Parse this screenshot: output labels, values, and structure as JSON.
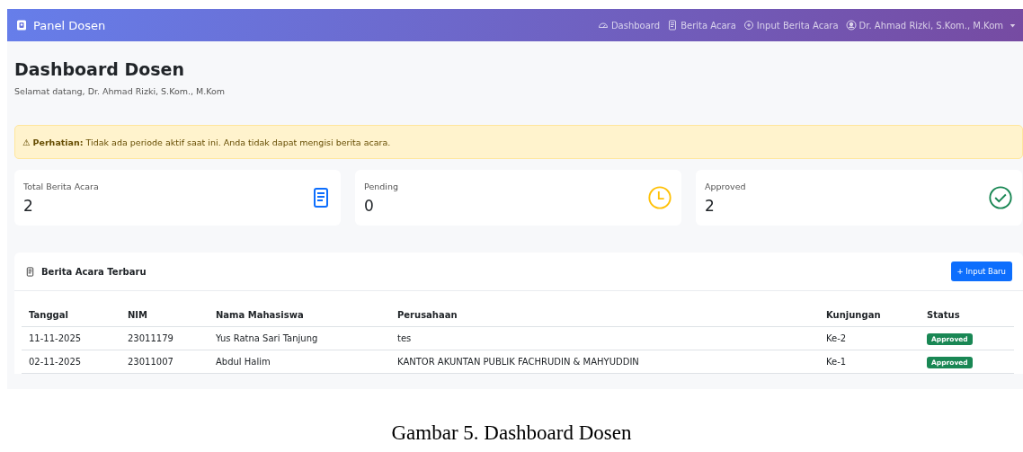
{
  "navbar": {
    "brand": "Panel Dosen",
    "items": [
      {
        "kind": "dashboard",
        "label": "Dashboard"
      },
      {
        "kind": "document",
        "label": "Berita Acara"
      },
      {
        "kind": "plus",
        "label": "Input Berita Acara"
      },
      {
        "kind": "user",
        "label": "Dr. Ahmad Rizki, S.Kom., M.Kom",
        "dropdown": true
      }
    ]
  },
  "page": {
    "title": "Dashboard Dosen",
    "subtitle": "Selamat datang, Dr. Ahmad Rizki, S.Kom., M.Kom"
  },
  "alert": {
    "icon": "⚠",
    "text": "**Perhatian:** Tidak ada periode aktif saat ini. Anda tidak dapat mengisi berita acara."
  },
  "stats": [
    {
      "kind": "document",
      "label": "Total Berita Acara",
      "value": "2",
      "color": "#0d6efd"
    },
    {
      "kind": "clock",
      "label": "Pending",
      "value": "0",
      "color": "#ffc107"
    },
    {
      "kind": "check",
      "label": "Approved",
      "value": "2",
      "color": "#198754"
    }
  ],
  "table": {
    "title": "Berita Acara Terbaru",
    "button": "+ Input Baru",
    "columns": [
      "Tanggal",
      "NIM",
      "Nama Mahasiswa",
      "Perusahaan",
      "Kunjungan",
      "Status"
    ],
    "rows": [
      [
        "11-11-2025",
        "23011179",
        "Yus Ratna Sari Tanjung",
        "tes",
        "Ke-2",
        "Approved"
      ],
      [
        "02-11-2025",
        "23011007",
        "Abdul Halim",
        "KANTOR AKUNTAN PUBLIK FACHRUDIN & MAHYUDDIN",
        "Ke-1",
        "Approved"
      ]
    ]
  },
  "caption": "Gambar 5. Dashboard Dosen"
}
